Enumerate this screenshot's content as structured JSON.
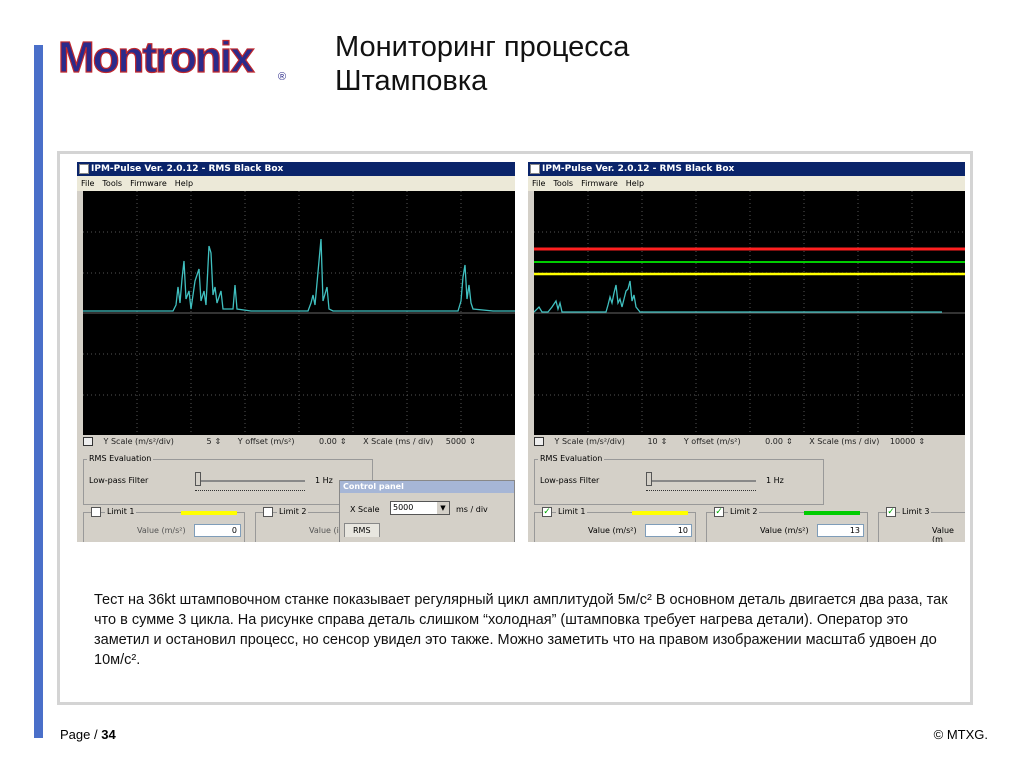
{
  "logo": {
    "text": "Montronix",
    "registered": "®"
  },
  "title": {
    "line1": "Мониторинг процесса",
    "line2": "Штамповка"
  },
  "left": {
    "window_title": "IPM-Pulse Ver. 2.0.12 - RMS Black Box",
    "menu": [
      "File",
      "Tools",
      "Firmware",
      "Help"
    ],
    "controls": {
      "y_scale_label": "Y Scale (m/s²/div)",
      "y_scale_value": "5",
      "y_offset_label": "Y offset (m/s²)",
      "y_offset_value": "0.00",
      "x_scale_label": "X Scale (ms / div)",
      "x_scale_value": "5000"
    },
    "rms_group": "RMS Evaluation",
    "filter_label": "Low-pass Filter",
    "filter_value": "1 Hz",
    "limit1": {
      "label": "Limit 1",
      "value_label": "Value (m/s²)",
      "value": "0",
      "color": "#ffff00"
    },
    "limit2": {
      "label": "Limit 2",
      "value_label": "Value (i"
    },
    "control_panel": {
      "title": "Control panel",
      "xscale_label": "X Scale",
      "xscale_value": "5000",
      "unit": "ms / div",
      "tab": "RMS"
    }
  },
  "right": {
    "window_title": "IPM-Pulse Ver. 2.0.12 - RMS Black Box",
    "menu": [
      "File",
      "Tools",
      "Firmware",
      "Help"
    ],
    "controls": {
      "y_scale_label": "Y Scale (m/s²/div)",
      "y_scale_value": "10",
      "y_offset_label": "Y offset (m/s²)",
      "y_offset_value": "0.00",
      "x_scale_label": "X Scale (ms / div)",
      "x_scale_value": "10000"
    },
    "rms_group": "RMS Evaluation",
    "filter_label": "Low-pass Filter",
    "filter_value": "1 Hz",
    "limit1": {
      "label": "Limit 1",
      "value_label": "Value (m/s²)",
      "value": "10",
      "color": "#ffff00"
    },
    "limit2": {
      "label": "Limit 2",
      "value_label": "Value (m/s²)",
      "value": "13",
      "color": "#00cc00"
    },
    "limit3": {
      "label": "Limit 3",
      "value_label": "Value (m"
    }
  },
  "body": "Тест на 36kt штамповочном станке показывает регулярный цикл амплитудой  5м/с² В основном деталь двигается два раза, так что в сумме 3 цикла. На рисунке справа деталь слишком “холодная” (штамповка требует нагрева детали). Оператор это заметил и остановил процесс, но сенсор увидел это также. Можно заметить что на правом изображении масштаб удвоен до 10м/с².",
  "footer": {
    "page_label": "Page /",
    "page_number": "34",
    "copyright": "© MTXG."
  },
  "colors": {
    "accent_bar": "#4a6fc9",
    "trace": "#40c0c0",
    "limit_red": "#ff2020",
    "limit_green": "#00cc00",
    "limit_yellow": "#ffff00"
  }
}
